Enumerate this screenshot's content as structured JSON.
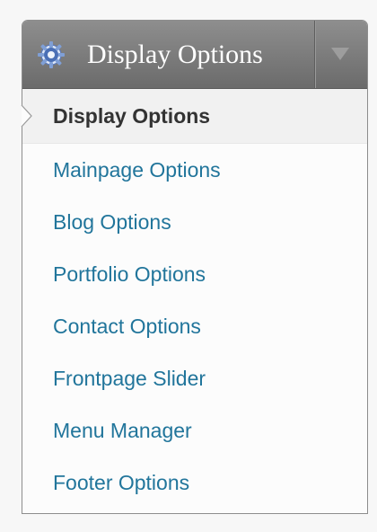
{
  "header": {
    "title": "Display Options",
    "icon": "gear-icon",
    "toggle_icon": "triangle-down-icon"
  },
  "menu": {
    "current_index": 0,
    "items": [
      {
        "label": "Display Options",
        "current": true
      },
      {
        "label": "Mainpage Options",
        "current": false
      },
      {
        "label": "Blog Options",
        "current": false
      },
      {
        "label": "Portfolio Options",
        "current": false
      },
      {
        "label": "Contact Options",
        "current": false
      },
      {
        "label": "Frontpage Slider",
        "current": false
      },
      {
        "label": "Menu Manager",
        "current": false
      },
      {
        "label": "Footer Options",
        "current": false
      }
    ]
  },
  "colors": {
    "link": "#21759b",
    "current_text": "#333333",
    "header_bg": "#7a7a7a",
    "icon_blue": "#4a6fb5"
  }
}
